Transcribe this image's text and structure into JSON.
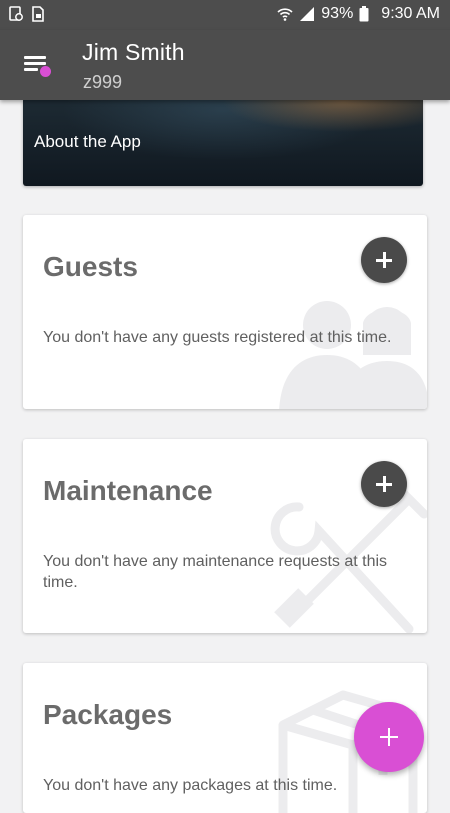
{
  "status_bar": {
    "battery": "93%",
    "time": "9:30 AM",
    "icons": [
      "notification-icon",
      "sim-icon",
      "wifi-icon",
      "signal-icon",
      "battery-icon"
    ]
  },
  "header": {
    "name": "Jim Smith",
    "user_id": "z999",
    "menu_icon": "hamburger-menu-icon",
    "badge_color": "#d94fd4"
  },
  "hero": {
    "label": "About the App"
  },
  "cards": [
    {
      "title": "Guests",
      "message": "You don't have any guests registered at this time.",
      "watermark_icon": "people-icon",
      "add_icon": "plus-icon"
    },
    {
      "title": "Maintenance",
      "message": "You don't have any maintenance requests at this time.",
      "watermark_icon": "tools-icon",
      "add_icon": "plus-icon"
    },
    {
      "title": "Packages",
      "message": "You don't have any packages at this time.",
      "watermark_icon": "box-icon"
    }
  ],
  "fab": {
    "icon": "plus-icon",
    "color": "#d94fd4"
  },
  "colors": {
    "header_bg": "#4d4d4d",
    "accent": "#d94fd4",
    "page_bg": "#f2f2f3"
  }
}
